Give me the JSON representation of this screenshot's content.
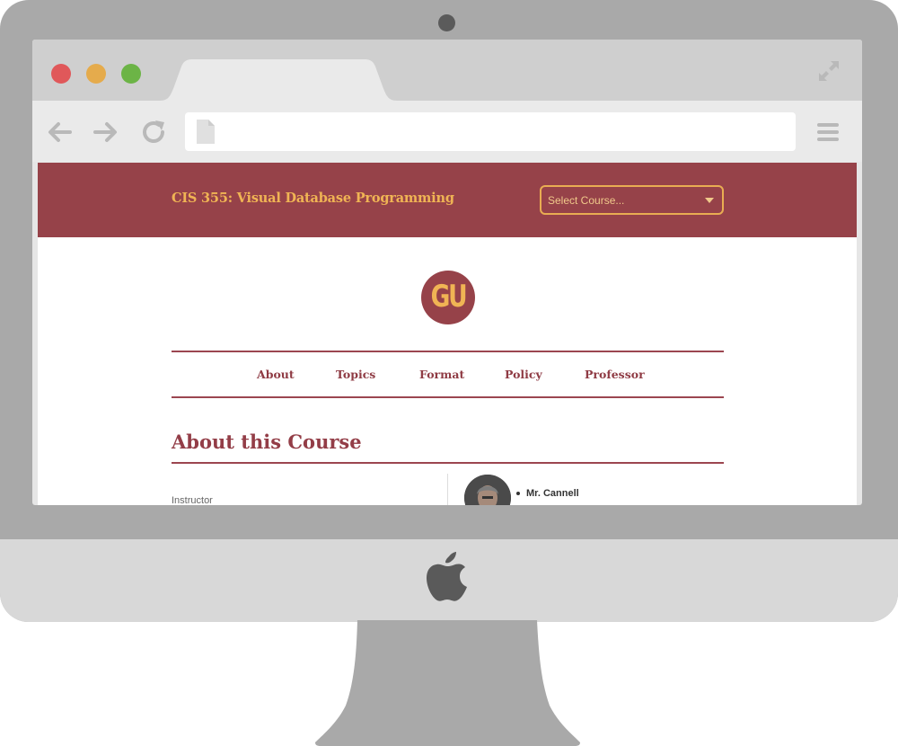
{
  "browser": {
    "address_value": ""
  },
  "site": {
    "title": "CIS 355: Visual Database Programming",
    "course_select": {
      "selected": "Select Course..."
    },
    "logo_text": "GU",
    "nav": [
      "About",
      "Topics",
      "Format",
      "Policy",
      "Professor"
    ],
    "section_title": "About this Course",
    "instructor_label": "Instructor",
    "professor_name": "Mr. Cannell"
  },
  "colors": {
    "brand": "#964249",
    "accent": "#f0b454"
  },
  "icons": {
    "back": "arrow-left-icon",
    "forward": "arrow-right-icon",
    "reload": "reload-icon",
    "page": "page-icon",
    "menu": "hamburger-menu-icon",
    "expand": "expand-icon",
    "apple": "apple-logo-icon"
  }
}
